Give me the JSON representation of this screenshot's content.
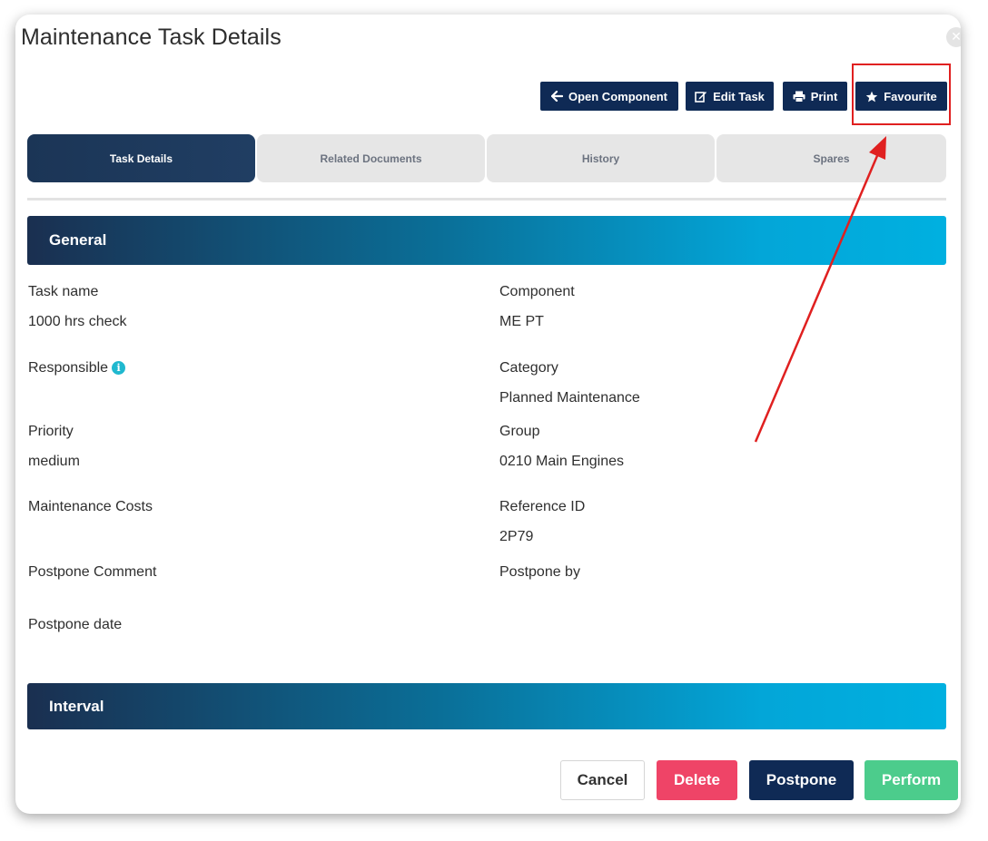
{
  "modal": {
    "title": "Maintenance Task Details",
    "close_icon": "close-icon"
  },
  "toolbar": {
    "open_component_label": "Open Component",
    "edit_task_label": "Edit Task",
    "print_label": "Print",
    "favourite_label": "Favourite"
  },
  "tabs": [
    {
      "label": "Task Details",
      "active": true
    },
    {
      "label": "Related Documents",
      "active": false
    },
    {
      "label": "History",
      "active": false
    },
    {
      "label": "Spares",
      "active": false
    }
  ],
  "sections": {
    "general": "General",
    "interval": "Interval"
  },
  "fields": {
    "task_name": {
      "label": "Task name",
      "value": "1000 hrs check"
    },
    "component": {
      "label": "Component",
      "value": "ME PT"
    },
    "responsible": {
      "label": "Responsible",
      "value": ""
    },
    "category": {
      "label": "Category",
      "value": "Planned Maintenance"
    },
    "priority": {
      "label": "Priority",
      "value": "medium"
    },
    "group": {
      "label": "Group",
      "value": "0210 Main Engines"
    },
    "maintenance_costs": {
      "label": "Maintenance Costs",
      "value": ""
    },
    "reference_id": {
      "label": "Reference ID",
      "value": "2P79"
    },
    "postpone_comment": {
      "label": "Postpone Comment",
      "value": ""
    },
    "postpone_by": {
      "label": "Postpone by",
      "value": ""
    },
    "postpone_date": {
      "label": "Postpone date",
      "value": ""
    }
  },
  "footer": {
    "cancel_label": "Cancel",
    "delete_label": "Delete",
    "postpone_label": "Postpone",
    "perform_label": "Perform"
  },
  "colors": {
    "primary_navy": "#0f2a55",
    "delete_red": "#ef4467",
    "perform_green": "#4ccc8c",
    "annotation_red": "#e02020",
    "header_gradient_end": "#00b0e0"
  }
}
